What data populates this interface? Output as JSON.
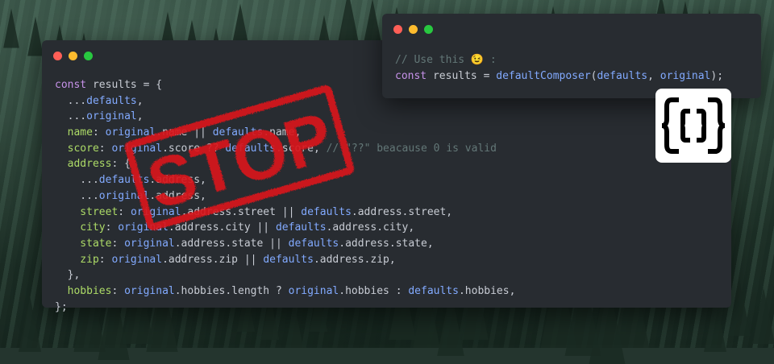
{
  "main_code": [
    [
      {
        "c": "kw",
        "t": "const "
      },
      {
        "c": "txt",
        "t": "results = {"
      }
    ],
    [
      {
        "c": "txt",
        "t": "  ..."
      },
      {
        "c": "var",
        "t": "defaults"
      },
      {
        "c": "txt",
        "t": ","
      }
    ],
    [
      {
        "c": "txt",
        "t": "  ..."
      },
      {
        "c": "var",
        "t": "original"
      },
      {
        "c": "txt",
        "t": ","
      }
    ],
    [
      {
        "c": "prop",
        "t": "  name"
      },
      {
        "c": "txt",
        "t": ": "
      },
      {
        "c": "var",
        "t": "original"
      },
      {
        "c": "txt",
        "t": ".name || "
      },
      {
        "c": "var",
        "t": "defaults"
      },
      {
        "c": "txt",
        "t": ".name,"
      }
    ],
    [
      {
        "c": "prop",
        "t": "  score"
      },
      {
        "c": "txt",
        "t": ": "
      },
      {
        "c": "var",
        "t": "original"
      },
      {
        "c": "txt",
        "t": ".score ?? "
      },
      {
        "c": "var",
        "t": "defaults"
      },
      {
        "c": "txt",
        "t": ".score, "
      },
      {
        "c": "cm",
        "t": "// \"??\" beacause 0 is valid"
      }
    ],
    [
      {
        "c": "prop",
        "t": "  address"
      },
      {
        "c": "txt",
        "t": ": {"
      }
    ],
    [
      {
        "c": "txt",
        "t": "    ..."
      },
      {
        "c": "var",
        "t": "defaults"
      },
      {
        "c": "txt",
        "t": ".address,"
      }
    ],
    [
      {
        "c": "txt",
        "t": "    ..."
      },
      {
        "c": "var",
        "t": "original"
      },
      {
        "c": "txt",
        "t": ".address,"
      }
    ],
    [
      {
        "c": "prop",
        "t": "    street"
      },
      {
        "c": "txt",
        "t": ": "
      },
      {
        "c": "var",
        "t": "original"
      },
      {
        "c": "txt",
        "t": ".address.street || "
      },
      {
        "c": "var",
        "t": "defaults"
      },
      {
        "c": "txt",
        "t": ".address.street,"
      }
    ],
    [
      {
        "c": "prop",
        "t": "    city"
      },
      {
        "c": "txt",
        "t": ": "
      },
      {
        "c": "var",
        "t": "original"
      },
      {
        "c": "txt",
        "t": ".address.city || "
      },
      {
        "c": "var",
        "t": "defaults"
      },
      {
        "c": "txt",
        "t": ".address.city,"
      }
    ],
    [
      {
        "c": "prop",
        "t": "    state"
      },
      {
        "c": "txt",
        "t": ": "
      },
      {
        "c": "var",
        "t": "original"
      },
      {
        "c": "txt",
        "t": ".address.state || "
      },
      {
        "c": "var",
        "t": "defaults"
      },
      {
        "c": "txt",
        "t": ".address.state,"
      }
    ],
    [
      {
        "c": "prop",
        "t": "    zip"
      },
      {
        "c": "txt",
        "t": ": "
      },
      {
        "c": "var",
        "t": "original"
      },
      {
        "c": "txt",
        "t": ".address.zip || "
      },
      {
        "c": "var",
        "t": "defaults"
      },
      {
        "c": "txt",
        "t": ".address.zip,"
      }
    ],
    [
      {
        "c": "txt",
        "t": "  },"
      }
    ],
    [
      {
        "c": "prop",
        "t": "  hobbies"
      },
      {
        "c": "txt",
        "t": ": "
      },
      {
        "c": "var",
        "t": "original"
      },
      {
        "c": "txt",
        "t": ".hobbies.length ? "
      },
      {
        "c": "var",
        "t": "original"
      },
      {
        "c": "txt",
        "t": ".hobbies : "
      },
      {
        "c": "var",
        "t": "defaults"
      },
      {
        "c": "txt",
        "t": ".hobbies,"
      }
    ],
    [
      {
        "c": "txt",
        "t": "};"
      }
    ]
  ],
  "small_code": [
    [
      {
        "c": "cm",
        "t": "// Use this 😉 :"
      }
    ],
    [
      {
        "c": "kw",
        "t": "const "
      },
      {
        "c": "txt",
        "t": "results = "
      },
      {
        "c": "fn",
        "t": "defaultComposer"
      },
      {
        "c": "txt",
        "t": "("
      },
      {
        "c": "var",
        "t": "defaults"
      },
      {
        "c": "txt",
        "t": ", "
      },
      {
        "c": "var",
        "t": "original"
      },
      {
        "c": "txt",
        "t": ");"
      }
    ]
  ],
  "stamp": {
    "text": "STOP",
    "color": "#d8181c"
  },
  "logo": {
    "icon": "curly-braces-logo-icon"
  },
  "colors": {
    "window_bg": "#282c31",
    "keyword": "#c792ea",
    "property": "#addb67",
    "variable": "#82aaff",
    "comment": "#637777"
  }
}
